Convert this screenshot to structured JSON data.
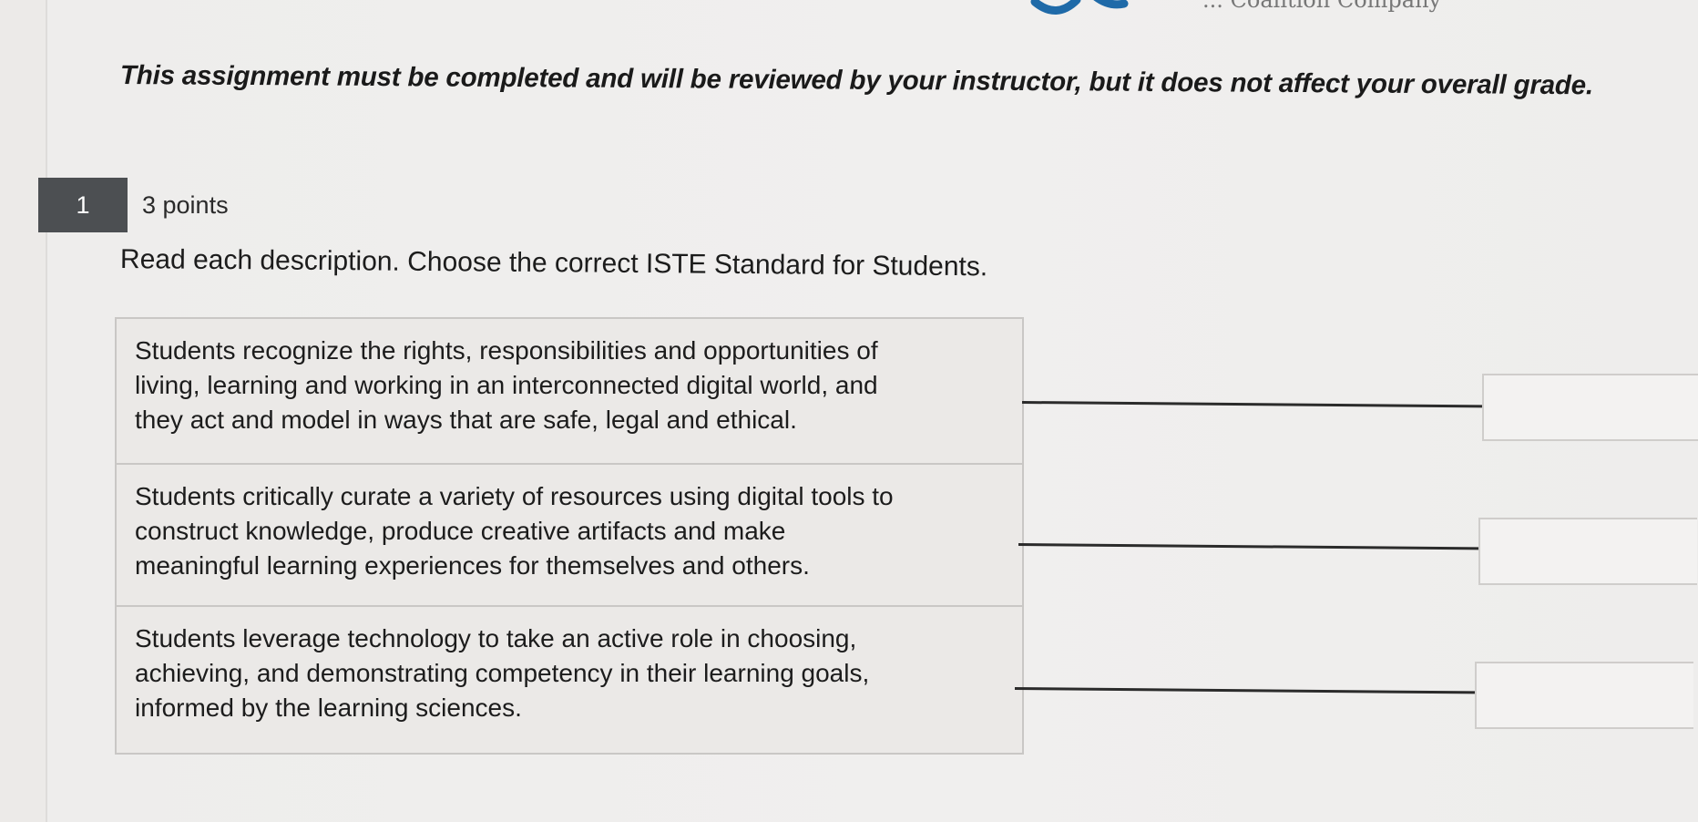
{
  "header": {
    "brand_text": "... Coalition Company",
    "logo_icon": "swoosh-logo-icon"
  },
  "notice": "This assignment must be completed and will be reviewed by your instructor, but it does not affect your overall grade.",
  "question": {
    "number": "1",
    "points": "3 points",
    "prompt": "Read each description. Choose the correct ISTE Standard for Students.",
    "items": [
      {
        "lines": [
          "Students recognize the rights, responsibilities and opportunities of",
          "living, learning and working in an interconnected digital world, and",
          "they act and model in ways that are safe, legal and ethical."
        ],
        "answer": ""
      },
      {
        "lines": [
          "Students critically curate a variety of resources using digital tools to",
          "construct knowledge, produce creative artifacts and make",
          "meaningful learning experiences for themselves and others."
        ],
        "answer": ""
      },
      {
        "lines": [
          "Students leverage technology to take an active role in choosing,",
          "achieving, and demonstrating competency in their learning goals,",
          "informed by the learning sciences."
        ],
        "answer": ""
      }
    ]
  },
  "colors": {
    "background": "#eceae8",
    "question_badge": "#4c4f52",
    "match_line": "#2b2b2b",
    "table_border": "#c9c7c5"
  }
}
